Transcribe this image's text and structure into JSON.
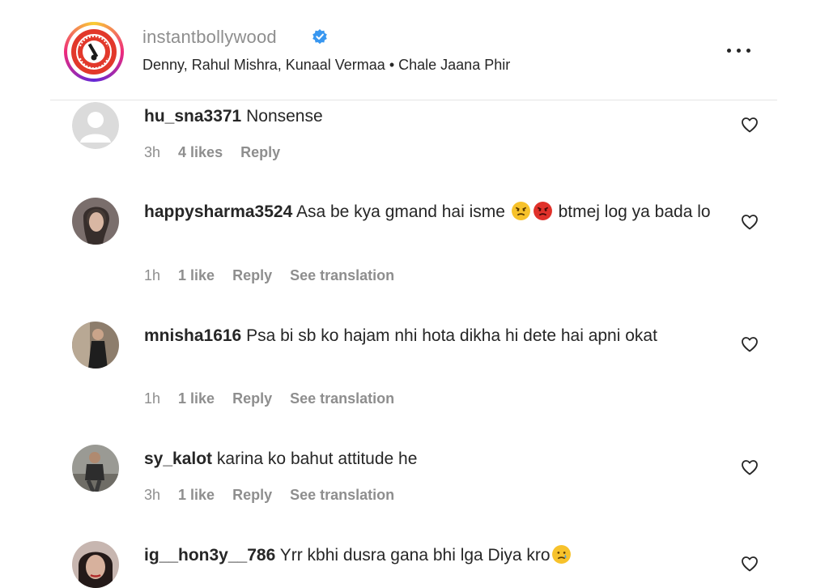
{
  "post": {
    "account": "instantbollywood",
    "audio_credits": "Denny, Rahul Mishra, Kunaal Vermaa • Chale Jaana Phir",
    "logo_text": "INSTANT BOLLYWOOD"
  },
  "comments": [
    {
      "username": "hu_sna3371",
      "text": "Nonsense",
      "time": "3h",
      "likes": "4 likes",
      "reply": "Reply"
    },
    {
      "username": "happysharma3524",
      "text": "Asa be kya gmand hai isme",
      "text_after": "btmej log ya bada lo",
      "time": "1h",
      "likes": "1 like",
      "reply": "Reply",
      "translate": "See translation"
    },
    {
      "username": "mnisha1616",
      "text": "Psa bi sb ko hajam nhi hota dikha hi dete hai apni okat",
      "time": "1h",
      "likes": "1 like",
      "reply": "Reply",
      "translate": "See translation"
    },
    {
      "username": "sy_kalot",
      "text": "karina ko bahut attitude he",
      "time": "3h",
      "likes": "1 like",
      "reply": "Reply",
      "translate": "See translation"
    },
    {
      "username": "ig__hon3y__786",
      "text": "Yrr kbhi dusra gana bhi lga Diya kro",
      "time": "",
      "likes": "",
      "reply": ""
    }
  ],
  "colors": {
    "text": "#262626",
    "secondary": "#8e8e8e",
    "verified": "#3897f0"
  }
}
